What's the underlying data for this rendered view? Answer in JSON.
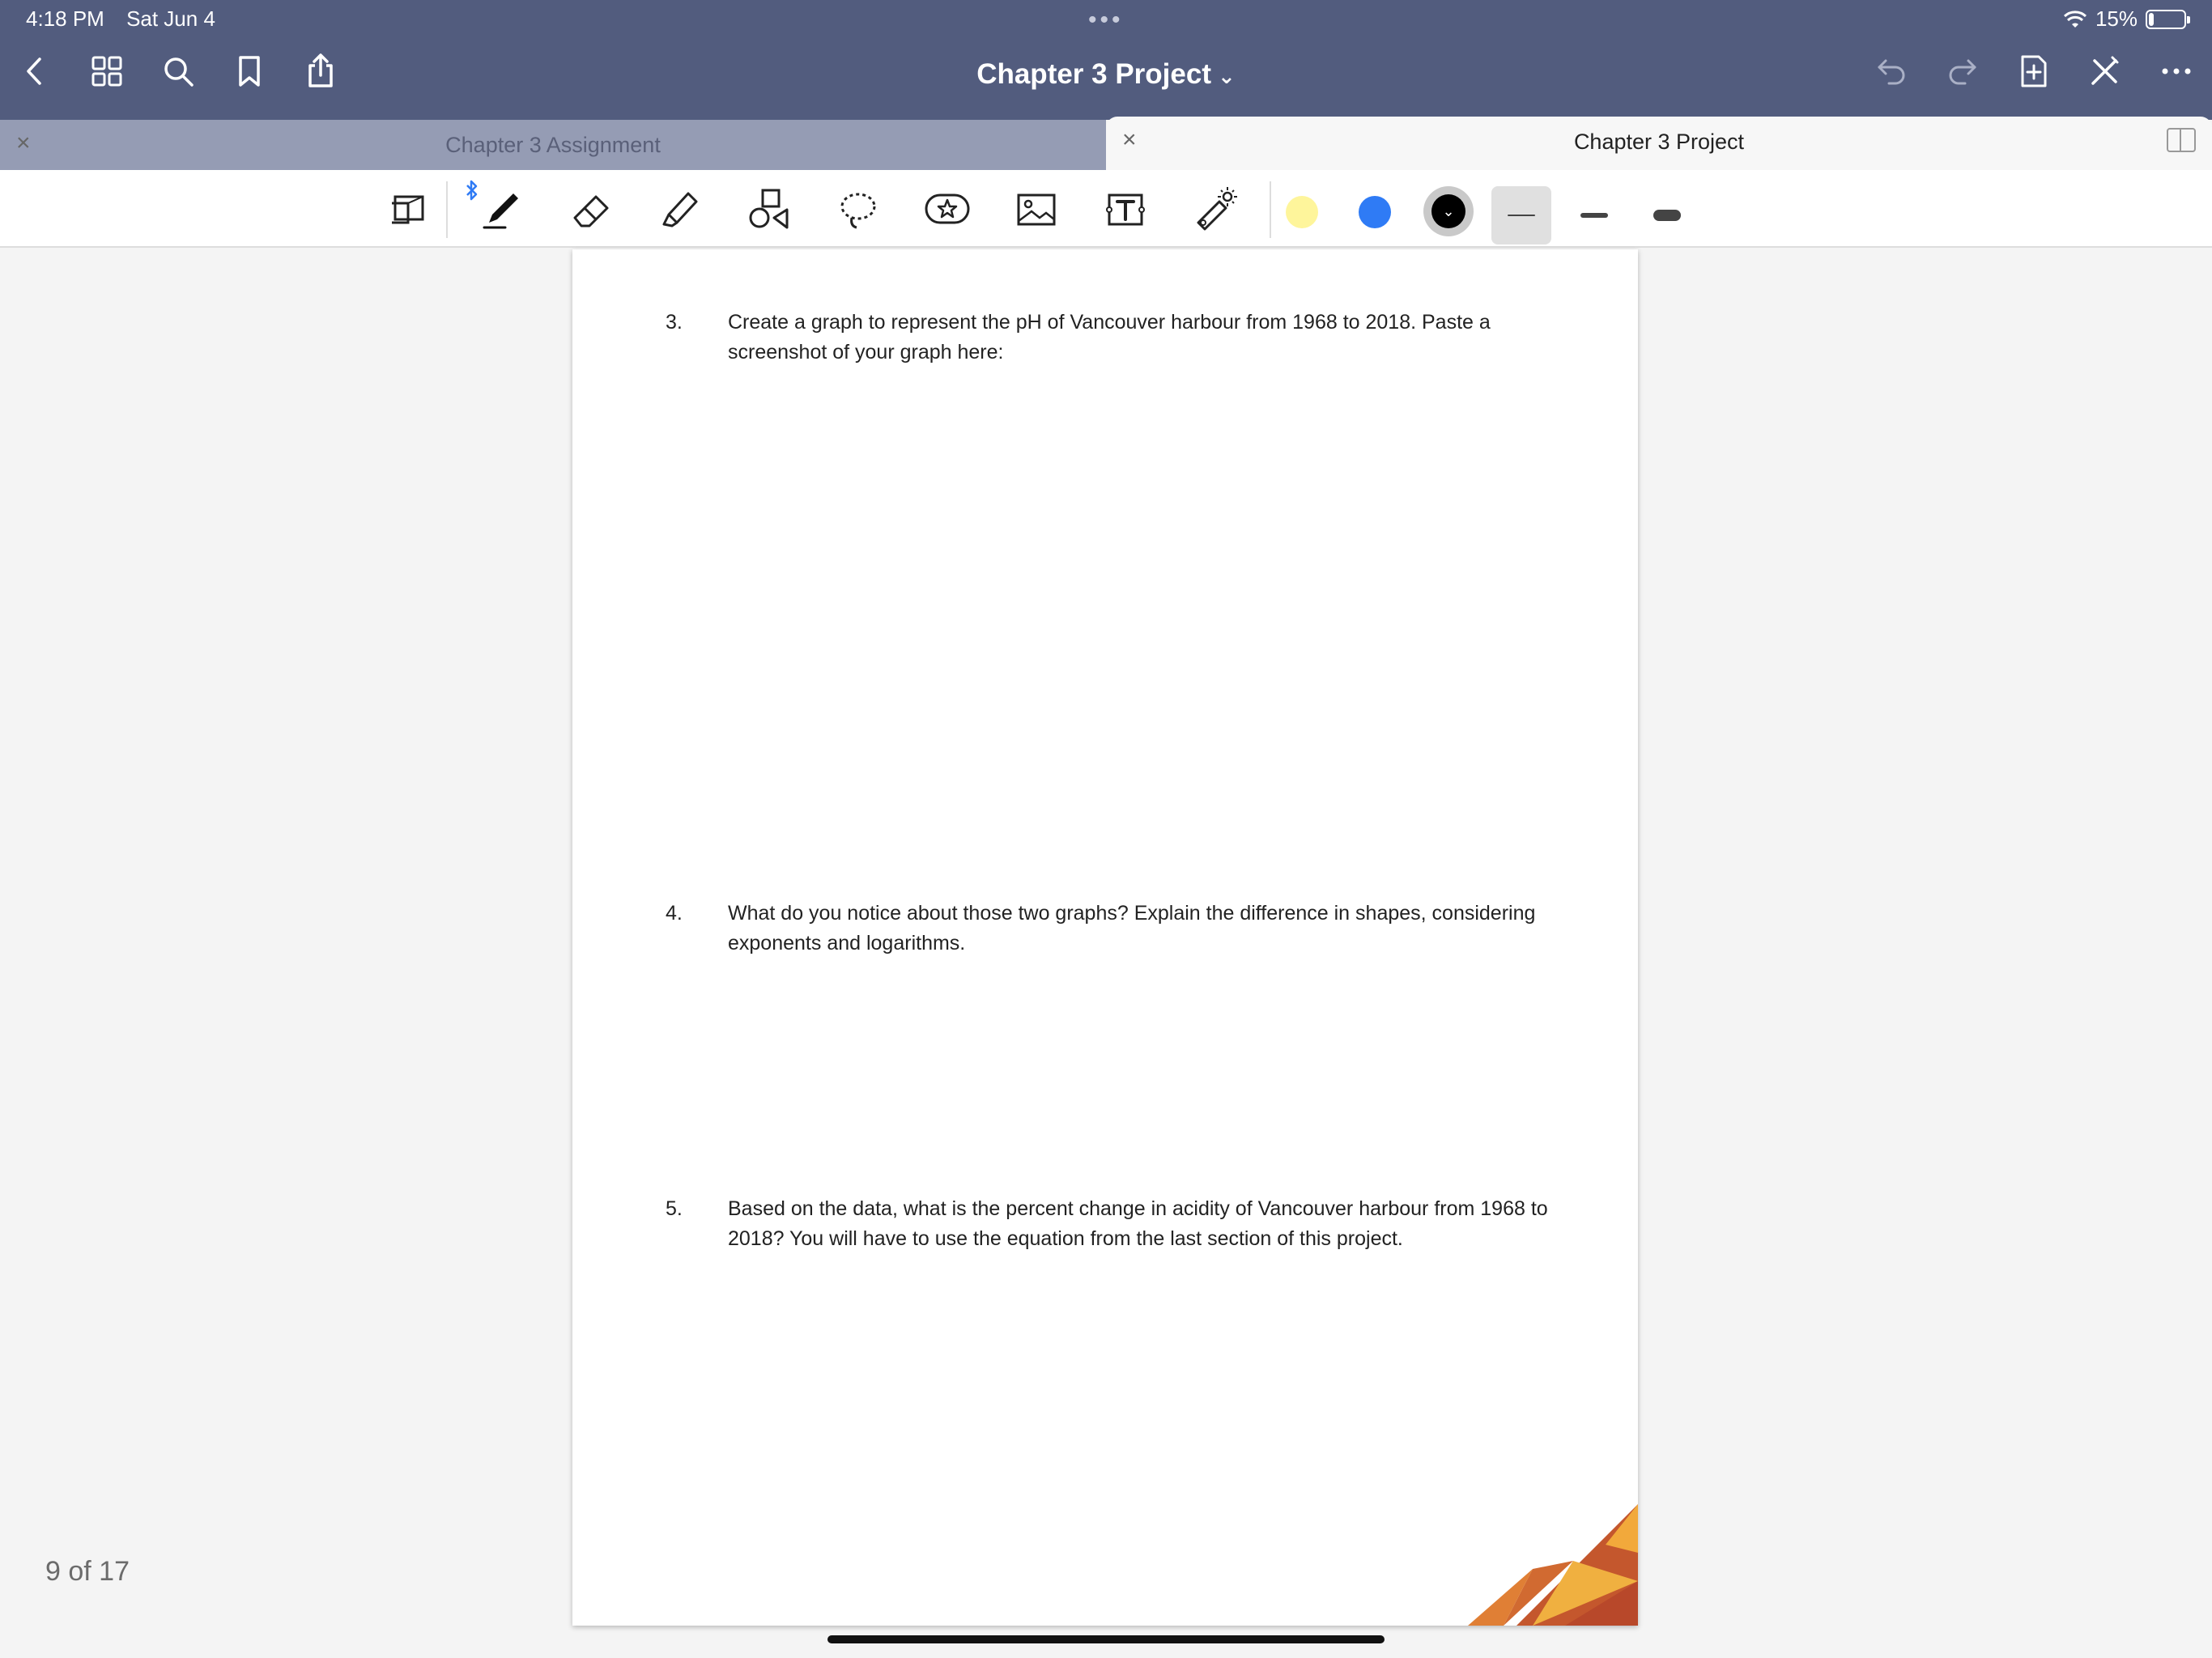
{
  "status_bar": {
    "time": "4:18 PM",
    "date": "Sat Jun 4",
    "dots": "•••",
    "battery_percent_label": "15%",
    "battery_level": 0.15
  },
  "header": {
    "title": "Chapter 3 Project",
    "title_chevron": "⌄",
    "left_icons": [
      "back-icon",
      "grid-icon",
      "search-icon",
      "bookmark-icon",
      "share-icon"
    ],
    "right_icons": [
      "undo-icon",
      "redo-icon",
      "add-page-icon",
      "close-toolbar-icon",
      "more-icon"
    ]
  },
  "tabs": [
    {
      "label": "Chapter 3 Assignment",
      "close": "×",
      "active": false
    },
    {
      "label": "Chapter 3 Project",
      "close": "×",
      "active": true
    }
  ],
  "toolbar": {
    "bluetooth_icon": "bluetooth-icon",
    "tools": [
      "zoom-window-icon",
      "pen-icon",
      "eraser-icon",
      "highlighter-icon",
      "shapes-icon",
      "lasso-icon",
      "elements-icon",
      "image-icon",
      "text-icon",
      "laser-pointer-icon"
    ],
    "colors": [
      "#fef59b",
      "#2f7bf5",
      "#000000"
    ],
    "selected_color": "#000000",
    "stroke_widths": [
      "thin",
      "medium",
      "thick"
    ],
    "selected_stroke": "thin"
  },
  "document": {
    "questions": [
      {
        "number": "3.",
        "text": "Create a graph to represent the pH of Vancouver harbour from 1968 to 2018. Paste a screenshot of your graph here:"
      },
      {
        "number": "4.",
        "text": "What do you notice about those two graphs? Explain the difference in shapes, considering exponents and logarithms."
      },
      {
        "number": "5.",
        "text": "Based on the data, what is the percent change in acidity of Vancouver harbour from 1968 to 2018? You will have to use the equation from the last section of this project."
      }
    ]
  },
  "page_counter": "9 of 17"
}
